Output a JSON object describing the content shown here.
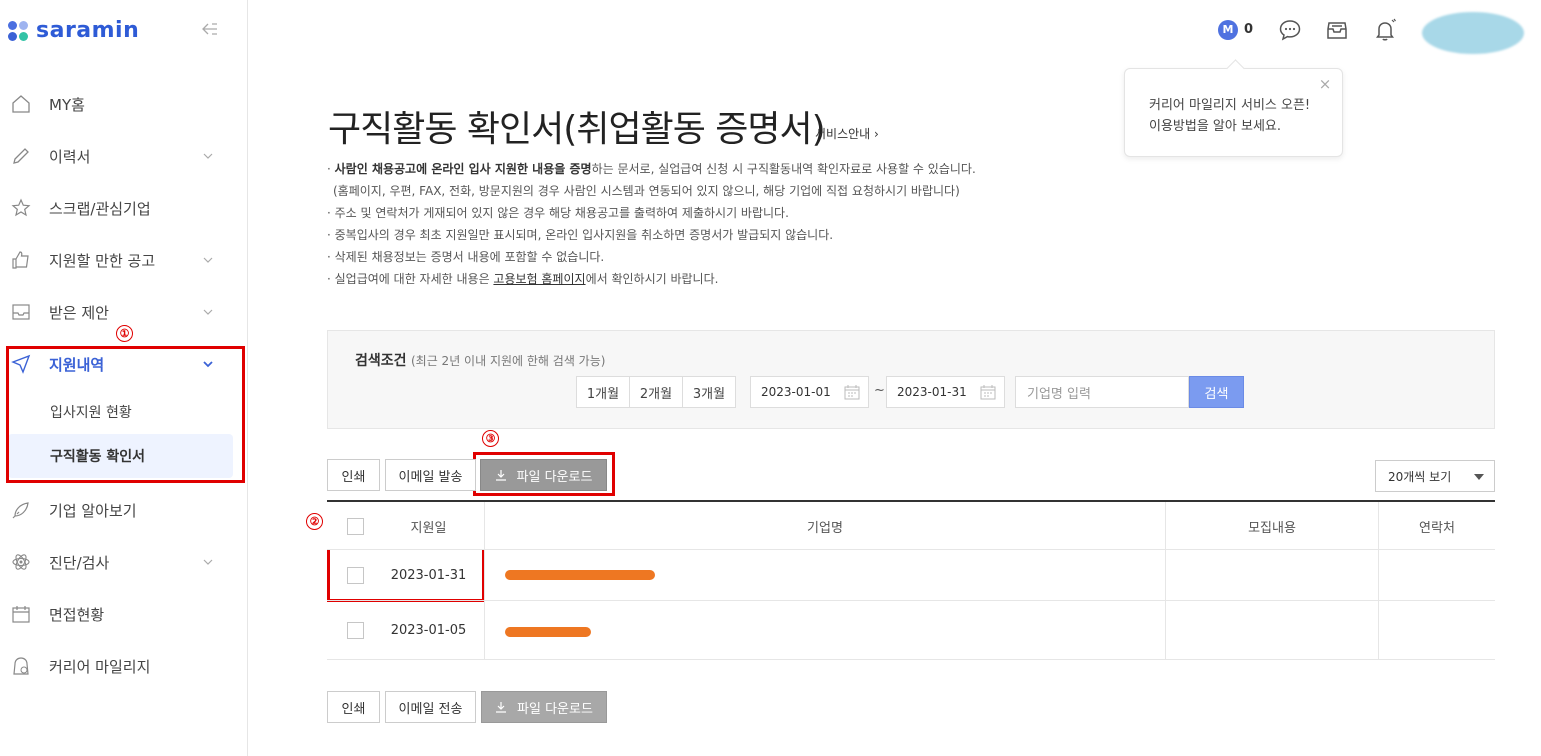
{
  "brand": {
    "logo_text": "saramin",
    "dot_colors": [
      "#4b6fe0",
      "#33c3a6",
      "#3b62d6",
      "#9fb4f0"
    ]
  },
  "sidebar": {
    "items": [
      {
        "label": "MY홈",
        "icon": "home-icon",
        "has_chevron": false
      },
      {
        "label": "이력서",
        "icon": "pencil-icon",
        "has_chevron": true
      },
      {
        "label": "스크랩/관심기업",
        "icon": "star-icon",
        "has_chevron": false
      },
      {
        "label": "지원할 만한 공고",
        "icon": "thumbs-up-icon",
        "has_chevron": true
      },
      {
        "label": "받은 제안",
        "icon": "envelope-icon",
        "has_chevron": true
      },
      {
        "label": "지원내역",
        "icon": "send-icon",
        "has_chevron": true,
        "active": true
      },
      {
        "label": "기업 알아보기",
        "icon": "rocket-icon",
        "has_chevron": false
      },
      {
        "label": "진단/검사",
        "icon": "atom-icon",
        "has_chevron": true
      },
      {
        "label": "면접현황",
        "icon": "calendar-icon",
        "has_chevron": false
      },
      {
        "label": "커리어 마일리지",
        "icon": "mileage-icon",
        "has_chevron": false
      }
    ],
    "sub_items": [
      {
        "label": "입사지원 현황"
      },
      {
        "label": "구직활동 확인서",
        "selected": true
      }
    ]
  },
  "annotations": {
    "m1": "①",
    "m2": "②",
    "m3": "③",
    "color": "#e00000"
  },
  "topbar": {
    "mileage_badge": "M",
    "mileage_count": "0"
  },
  "popover": {
    "line1": "커리어 마일리지 서비스 오픈!",
    "line2": "이용방법을 알아 보세요.",
    "close": "×"
  },
  "page": {
    "title": "구직활동 확인서(취업활동 증명서)",
    "service_link": "서비스안내",
    "notes": {
      "n1_bold": "사람인 채용공고에 온라인 입사 지원한 내용을 증명",
      "n1_rest": "하는 문서로, 실업급여 신청 시 구직활동내역 확인자료로 사용할 수 있습니다.",
      "n1_sub": "(홈페이지, 우편, FAX, 전화, 방문지원의 경우 사람인 시스템과 연동되어 있지 않으니, 해당 기업에 직접 요청하시기 바랍니다)",
      "n2": "주소 및 연락처가 게재되어 있지 않은 경우 해당 채용공고를 출력하여 제출하시기 바랍니다.",
      "n3": "중복입사의 경우 최초 지원일만 표시되며, 온라인 입사지원을 취소하면 증명서가 발급되지 않습니다.",
      "n4": "삭제된 채용정보는 증명서 내용에 포함할 수 없습니다.",
      "n5_pre": "실업급여에 대한 자세한 내용은 ",
      "n5_link": "고용보험 홈페이지",
      "n5_post": "에서 확인하시기 바랍니다."
    }
  },
  "search": {
    "title": "검색조건",
    "hint": "(최근 2년 이내 지원에 한해 검색 가능)",
    "periods": [
      "1개월",
      "2개월",
      "3개월"
    ],
    "date_from": "2023-01-01",
    "tilde": "~",
    "date_to": "2023-01-31",
    "company_placeholder": "기업명 입력",
    "button": "검색"
  },
  "actions_top": {
    "print": "인쇄",
    "email": "이메일 발송",
    "download": "파일 다운로드"
  },
  "actions_bottom": {
    "print": "인쇄",
    "email": "이메일 전송",
    "download": "파일 다운로드"
  },
  "view_select": "20개씩 보기",
  "table": {
    "headers": {
      "date": "지원일",
      "company": "기업명",
      "recruit": "모집내용",
      "contact": "연락처"
    },
    "rows": [
      {
        "date": "2023-01-31",
        "company": "",
        "recruit": "",
        "contact": ""
      },
      {
        "date": "2023-01-05",
        "company": "",
        "recruit": "",
        "contact": ""
      }
    ]
  }
}
